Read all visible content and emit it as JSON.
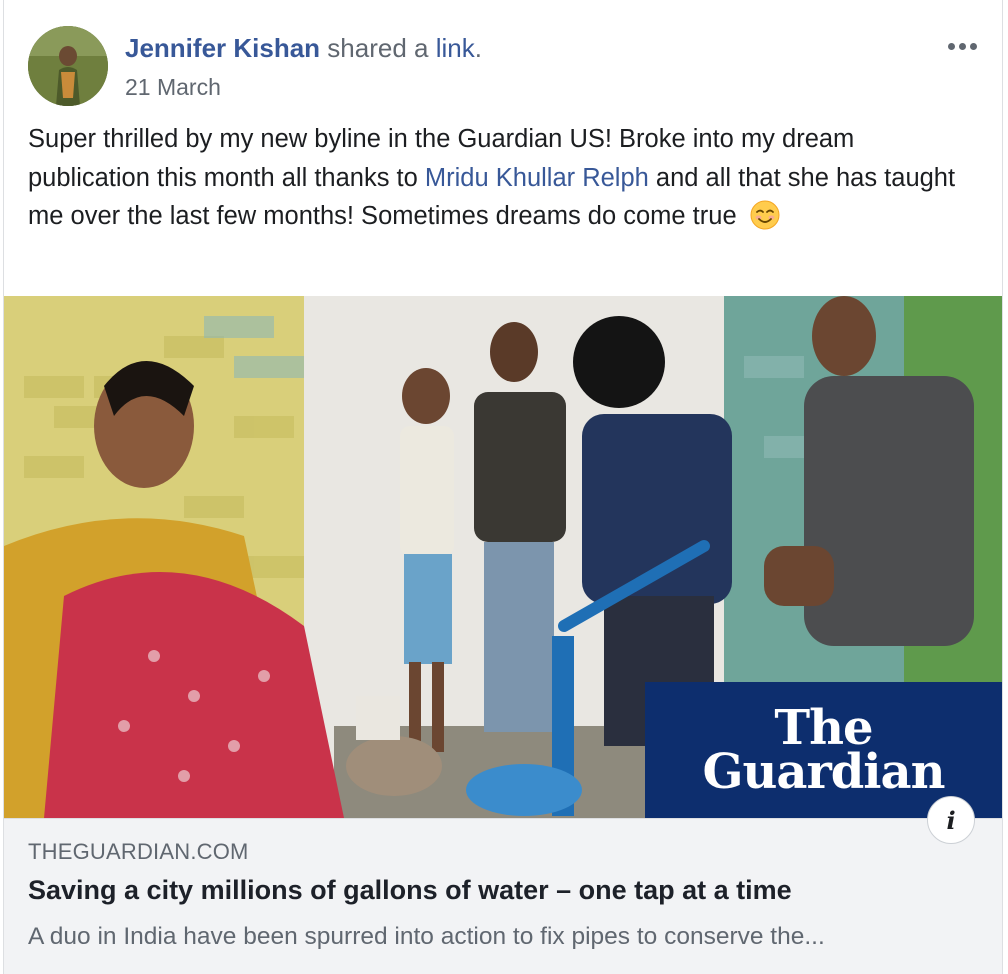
{
  "post": {
    "author": "Jennifer Kishan",
    "shared_text": "shared a",
    "shared_link": "link",
    "shared_period": ".",
    "date": "21 March",
    "text_part1": "Super thrilled by my new byline in the Guardian US! Broke into my dream publication this month all thanks to ",
    "mention": "Mridu Khullar Relph",
    "text_part2": " and all that she has taught me over the last few months! Sometimes dreams do come true",
    "emoji": "smiling-face-with-smiling-eyes"
  },
  "link_card": {
    "image_overlay_line1": "The",
    "image_overlay_line2": "Guardian",
    "info_label": "i",
    "domain": "THEGUARDIAN.COM",
    "headline": "Saving a city millions of gallons of water – one tap at a time",
    "description": "A duo in India have been spurred into action to fix pipes to conserve the..."
  },
  "colors": {
    "link": "#385898",
    "secondary_text": "#606770",
    "guardian_blue": "#0d2e6e",
    "card_background": "#f2f3f5"
  }
}
